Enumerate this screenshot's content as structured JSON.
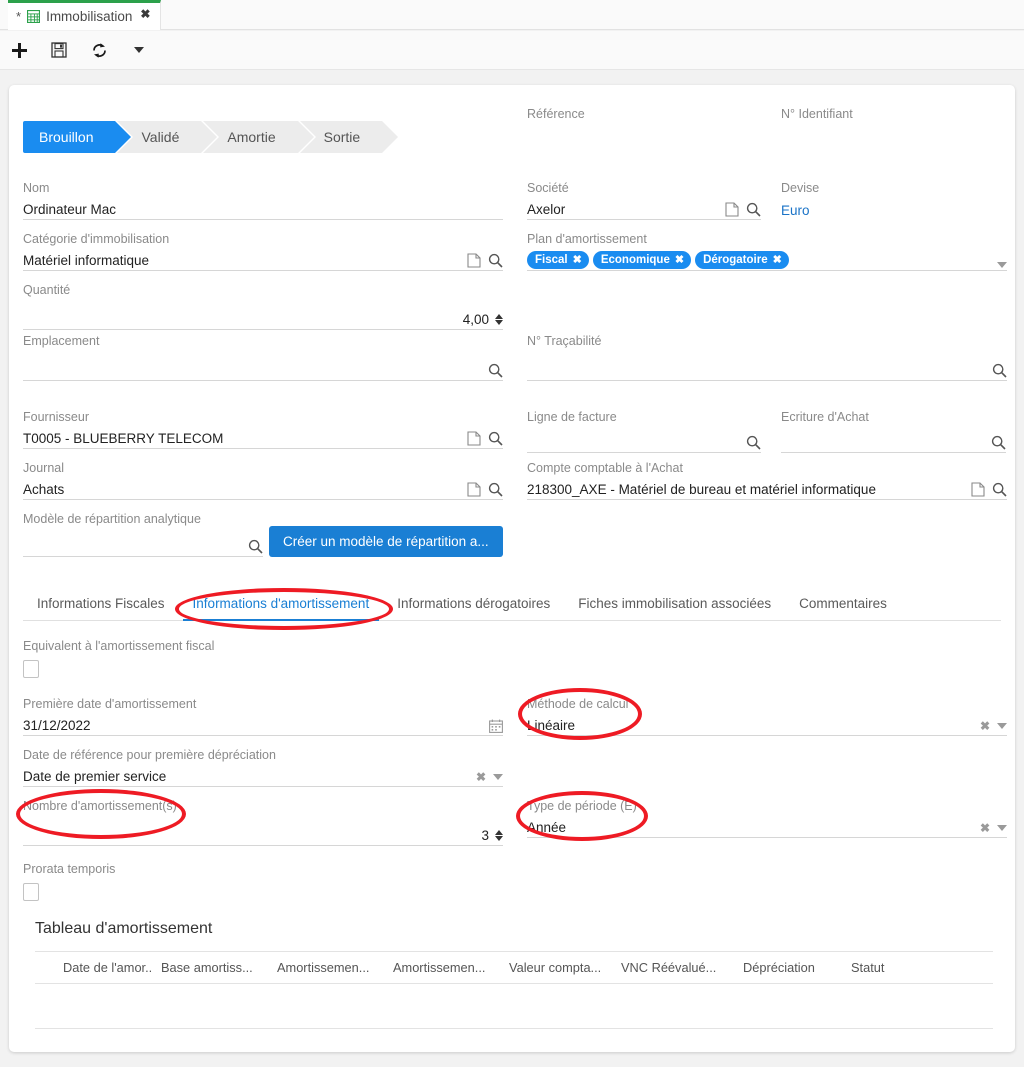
{
  "window": {
    "tab": {
      "modified_marker": "*",
      "icon": "grid-icon",
      "title": "Immobilisation",
      "close": "✖"
    },
    "toolbar": {
      "new_label": "+",
      "save_label": "save-icon",
      "refresh_label": "refresh-icon",
      "more_label": "chevron-down-icon"
    }
  },
  "status_bar": {
    "steps": [
      {
        "label": "Brouillon",
        "active": true
      },
      {
        "label": "Validé",
        "active": false
      },
      {
        "label": "Amortie",
        "active": false
      },
      {
        "label": "Sortie",
        "active": false
      }
    ]
  },
  "fields": {
    "nom": {
      "label": "Nom",
      "value": "Ordinateur Mac"
    },
    "categorie": {
      "label": "Catégorie d'immobilisation",
      "value": "Matériel informatique"
    },
    "quantite": {
      "label": "Quantité",
      "value": "4,00"
    },
    "emplacement": {
      "label": "Emplacement",
      "value": ""
    },
    "fournisseur": {
      "label": "Fournisseur",
      "value": "T0005 - BLUEBERRY TELECOM"
    },
    "journal": {
      "label": "Journal",
      "value": "Achats"
    },
    "modele_repartition": {
      "label": "Modèle de répartition analytique",
      "value": ""
    },
    "creer_modele_btn": {
      "label": "Créer un modèle de répartition a..."
    },
    "reference": {
      "label": "Référence",
      "value": ""
    },
    "identifiant": {
      "label": "N° Identifiant",
      "value": ""
    },
    "societe": {
      "label": "Société",
      "value": "Axelor"
    },
    "devise": {
      "label": "Devise",
      "value": "Euro"
    },
    "plan_amortissement": {
      "label": "Plan d'amortissement",
      "chips": [
        "Fiscal",
        "Economique",
        "Dérogatoire"
      ]
    },
    "tracabilite": {
      "label": "N° Traçabilité",
      "value": ""
    },
    "ligne_facture": {
      "label": "Ligne de facture",
      "value": ""
    },
    "ecriture_achat": {
      "label": "Ecriture d'Achat",
      "value": ""
    },
    "compte_comptable": {
      "label": "Compte comptable à l'Achat",
      "value": "218300_AXE - Matériel de bureau et matériel informatique"
    }
  },
  "tabs": [
    {
      "label": "Informations Fiscales",
      "active": false
    },
    {
      "label": "Informations d'amortissement",
      "active": true
    },
    {
      "label": "Informations dérogatoires",
      "active": false
    },
    {
      "label": "Fiches immobilisation associées",
      "active": false
    },
    {
      "label": "Commentaires",
      "active": false
    }
  ],
  "amortissement": {
    "equivalent_fiscal": {
      "label": "Equivalent à l'amortissement fiscal",
      "checked": false
    },
    "premiere_date": {
      "label": "Première date d'amortissement",
      "value": "31/12/2022"
    },
    "date_reference": {
      "label": "Date de référence pour première dépréciation",
      "value": "Date de premier service"
    },
    "nombre_amortissements": {
      "label": "Nombre d'amortissement(s)",
      "value": "3"
    },
    "methode_calcul": {
      "label": "Méthode de calcul",
      "value": "Linéaire"
    },
    "type_periode": {
      "label": "Type de période (E)",
      "value": "Année"
    },
    "prorata_temporis": {
      "label": "Prorata temporis",
      "checked": false
    }
  },
  "grid": {
    "title": "Tableau d'amortissement",
    "columns": [
      "Date de l'amor...",
      "Base amortiss...",
      "Amortissemen...",
      "Amortissemen...",
      "Valeur compta...",
      "VNC Réévalué...",
      "Dépréciation",
      "Statut"
    ],
    "rows": []
  },
  "annotations": {
    "color": "#ee1b24",
    "targets": [
      "tab-informations-amortissement",
      "methode-de-calcul",
      "nombre-amortissements",
      "type-de-periode"
    ]
  }
}
